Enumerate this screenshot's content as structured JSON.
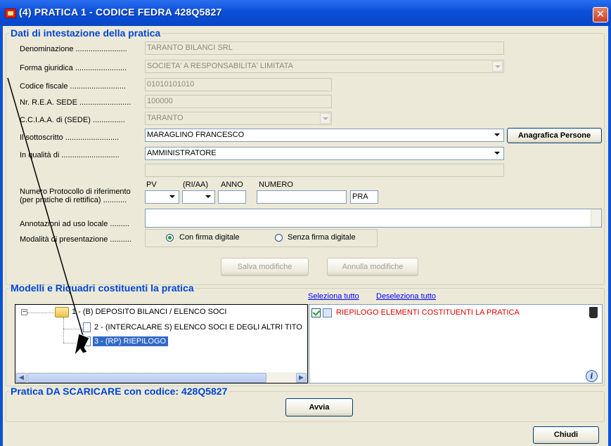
{
  "window": {
    "title": "(4) PRATICA 1 - CODICE FEDRA 428Q5827",
    "close_glyph": "✕"
  },
  "intestazione": {
    "legend": "Dati di intestazione della pratica",
    "denominazione": {
      "label": "Denominazione ........................",
      "value": "TARANTO BILANCI SRL"
    },
    "forma_giuridica": {
      "label": "Forma giuridica ........................",
      "value": "SOCIETA' A RESPONSABILITA' LIMITATA"
    },
    "codice_fiscale": {
      "label": "Codice fiscale ..........................",
      "value": "01010101010"
    },
    "rea": {
      "label": "Nr. R.E.A. SEDE ........................",
      "value": "100000"
    },
    "cciaa": {
      "label": "C.C.I.A.A. di (SEDE) ...............",
      "value": "TARANTO"
    },
    "sottoscritto": {
      "label": "Il sottoscritto .........................",
      "value": "MARAGLINO FRANCESCO",
      "button": "Anagrafica Persone"
    },
    "qualita": {
      "label": "In qualità di ...........................",
      "value": "AMMINISTRATORE"
    },
    "protocollo": {
      "label_line1": "Numero Protocollo di riferimento",
      "label_line2": "(per pratiche di rettifica) ...........",
      "col_pv": "PV",
      "col_riaa": "(RI/AA)",
      "col_anno": "ANNO",
      "col_numero": "NUMERO",
      "suffix_value": "PRA"
    },
    "annotazioni": {
      "label": "Annotazioni ad  uso locale ........."
    },
    "modalita": {
      "label": "Modalità di presentazione ..........",
      "option_con": "Con firma digitale",
      "option_senza": "Senza firma digitale",
      "selected": "Con firma digitale"
    },
    "salva_button": "Salva modifiche",
    "annulla_button": "Annulla modifiche"
  },
  "modelli": {
    "legend": "Modelli e Riquadri costituenti la pratica",
    "seleziona_tutto": "Seleziona tutto",
    "deseleziona_tutto": "Deseleziona tutto",
    "tree": [
      {
        "label": "1 - (B) DEPOSITO BILANCI / ELENCO SOCI"
      },
      {
        "label": "2 - (INTERCALARE S) ELENCO SOCI E DEGLI ALTRI TITO"
      },
      {
        "label": "3 - (RP) RIEPILOGO"
      }
    ],
    "list_items": [
      {
        "label": "RIEPILOGO ELEMENTI COSTITUENTI LA PRATICA",
        "checked": true
      }
    ]
  },
  "scaricare": {
    "legend": "Pratica DA SCARICARE con codice: 428Q5827",
    "avvia_button": "Avvia"
  },
  "chiudi_button": "Chiudi",
  "colors": {
    "title_bar": "#0a4fd8",
    "legend_text": "#0046d5",
    "link_text": "#0000ff",
    "list_item_text": "#e00000",
    "tree_selected": "#316ac5"
  }
}
